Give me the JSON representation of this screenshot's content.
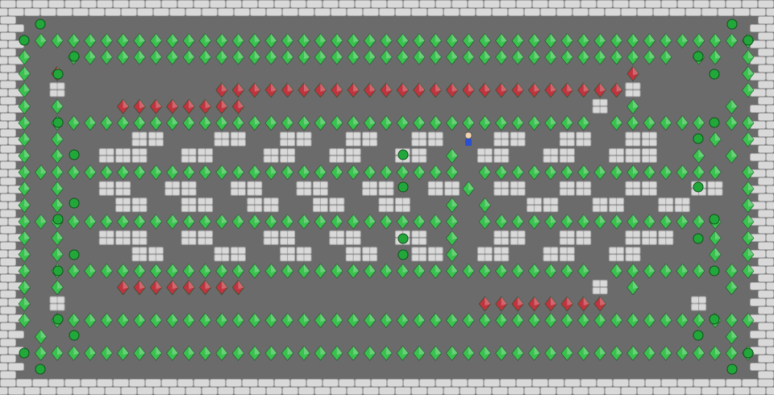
{
  "game": {
    "title": "",
    "colors": {
      "floor": "#6b6b6b",
      "wall": "#d9d9d9",
      "wall_mortar": "#a9a9a9",
      "goal_green": "#22a83a",
      "box_green": "#39c24e",
      "box_red": "#c0343f",
      "player_blue": "#2a4fd0"
    },
    "legend": {
      "wall": "wall-brick",
      "green_diamond": "box-on-goal",
      "red_diamond": "box-off-goal",
      "green_dot": "empty-goal",
      "player": "player"
    },
    "grid": {
      "cols": 47,
      "rows": 24,
      "rows_text": [
        "###############################################",
        "#.............................................#",
        "#.*********************************************#",
        "#*..*************************************.**.**#",
        "#*.$..................................$......*.*#",
        "#*.#.........$$$$$$$$$$$$$$$$$$$$$$$$$#......*.*#",
        "#*.*...$$$$$$$$.....................#.*.....*.*#",
        "#*.*********************************.******.***#",
        "#*.*....##...##..##..##..##.@.##..##..##...*.*#",
        "#*.*..###..##...##..##..##.*.##..##..###..*.*#",
        "#***************************.***************.**#",
        "#*.*..##..##..##..##..##..##*.##..##..##..##.*.#",
        "#*.*...##..##..##..##..##..*.*..##..##..##...*.#",
        "#***************************.***************.**#",
        "#*.*..###..##...##..##..##.*..##..##..###..*.*#",
        "#*.*....##...##..##..##..##*.##..##..##....*.*#",
        "#*.*********************************.******.***#",
        "#*.*...$$$$$$$$.....................#.*.....*.*#",
        "#*.#.........................$$$$$$$$.....#...*#",
        "#*.*********************************************#",
        "#.*.........................................*.*#",
        "#.*********************************************#",
        "#.............................................#",
        "###############################################"
      ]
    }
  }
}
